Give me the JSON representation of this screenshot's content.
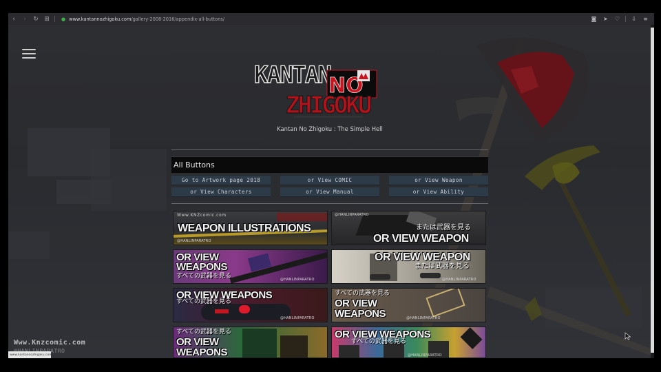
{
  "browser": {
    "url_domain": "www.kantannozhigoku.com",
    "url_path": "/gallery-2008-2016/appendix-all-buttons/",
    "icons": [
      "back-icon",
      "forward-icon",
      "reload-icon",
      "apps-icon",
      "lock-icon",
      "camera-icon",
      "send-icon",
      "heart-icon",
      "download-icon",
      "menu-icon"
    ]
  },
  "site": {
    "logo_text_top": "KANTAN",
    "logo_text_no": "NO",
    "logo_text_bottom": "ZHIGOKU",
    "tagline": "Kantan No Zhigoku : The Simple Hell"
  },
  "section": {
    "title": "All Buttons"
  },
  "nav_buttons": [
    {
      "label": "Go to Artwork page 2018"
    },
    {
      "label": "or View COMIC"
    },
    {
      "label": "or View Weapon"
    },
    {
      "label": "or View Characters"
    },
    {
      "label": "or View Manual"
    },
    {
      "label": "or View Ability"
    }
  ],
  "tiles": [
    {
      "line1": "WEAPON ILLUSTRATIONS",
      "site": "Www.KNZcomic.com",
      "credit": "@HANLINPARATRO"
    },
    {
      "line1": "OR VIEW WEAPON",
      "jp": "または武器を見る",
      "credit": "@HANLINPARATRO"
    },
    {
      "line1": "OR VIEW",
      "line2": "WEAPONS",
      "jp": "すべての武器を見る",
      "credit": "@HANLINPARATRO"
    },
    {
      "line1": "OR VIEW WEAPON",
      "jp": "または武器を見る",
      "credit": "@HANLINPARATRO"
    },
    {
      "line1": "OR VIEW WEAPONS",
      "jp": "すべての武器を見る",
      "credit": "@HANLINPARATRO"
    },
    {
      "line1": "OR VIEW",
      "line2": "WEAPONS",
      "jp": "すべての武器を見る",
      "credit": "@HANLINPARATRO"
    },
    {
      "line1": "OR VIEW",
      "line2": "WEAPONS",
      "jp": "すべての武器を見る"
    },
    {
      "line1": "OR VIEW WEAPONS",
      "jp": "すべての武器を見る",
      "credit": "@HANLINPARATRO"
    }
  ],
  "watermark": {
    "site": "Www.Knzcomic.com",
    "credit": "@HANLINPARATRO"
  },
  "status_text": "www.kantannozhigoku.com",
  "colors": {
    "accent_red": "#c8141e",
    "button_bg": "#2d3a48",
    "page_bg": "#2d2e32"
  }
}
